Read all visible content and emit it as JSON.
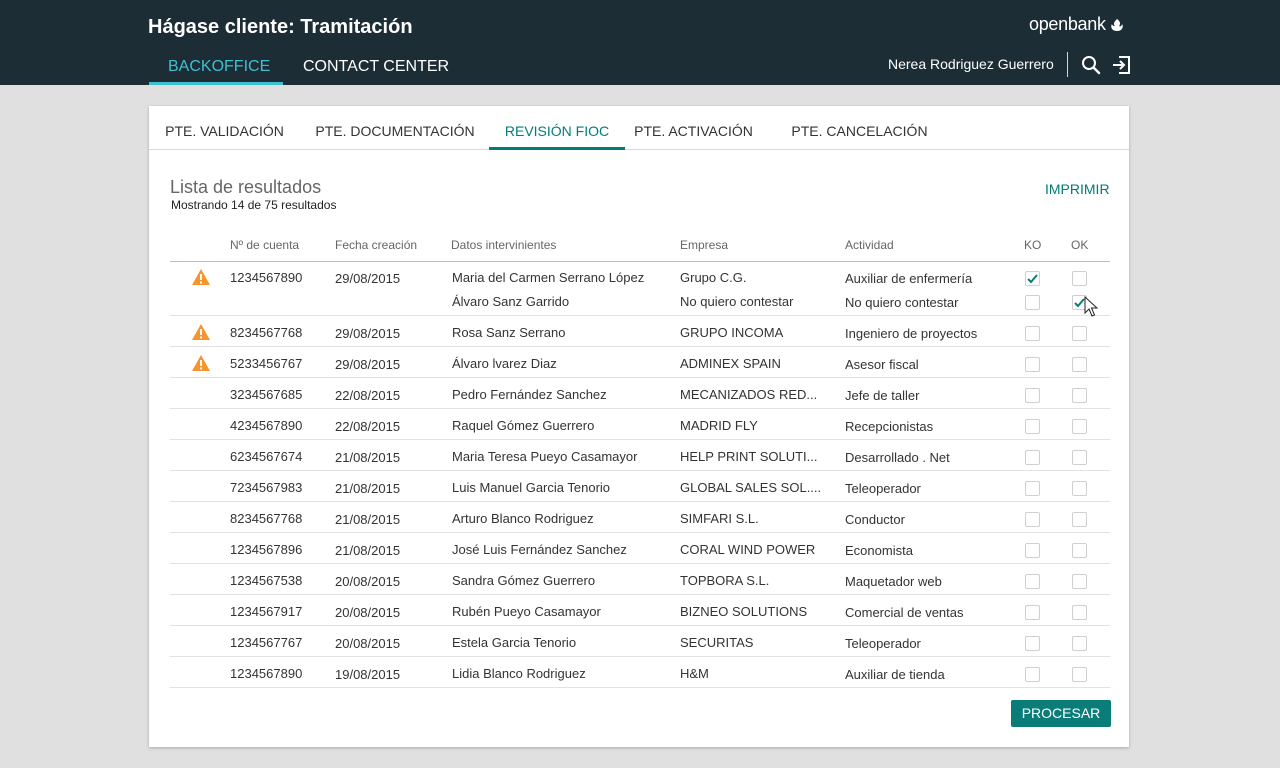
{
  "header": {
    "title": "Hágase cliente: Tramitación",
    "logo_text": "openbank",
    "nav": [
      {
        "label": "BACKOFFICE",
        "active": true
      },
      {
        "label": "CONTACT CENTER",
        "active": false
      }
    ],
    "user_name": "Nerea Rodriguez Guerrero",
    "search_icon": "search-icon",
    "logout_icon": "logout-icon"
  },
  "tabs": [
    {
      "label": "PTE. VALIDACIÓN",
      "active": false
    },
    {
      "label": "PTE. DOCUMENTACIÓN",
      "active": false
    },
    {
      "label": "REVISIÓN FIOC",
      "active": true
    },
    {
      "label": "PTE. ACTIVACIÓN",
      "active": false
    },
    {
      "label": "PTE. CANCELACIÓN",
      "active": false
    }
  ],
  "results": {
    "title": "Lista de resultados",
    "subtitle": "Mostrando 14 de 75 resultados",
    "print_label": "IMPRIMIR"
  },
  "table": {
    "columns": {
      "account": "Nº de cuenta",
      "date": "Fecha creación",
      "people": "Datos intervinientes",
      "company": "Empresa",
      "activity": "Actividad",
      "ko": "KO",
      "ok": "OK"
    },
    "rows": [
      {
        "warning": true,
        "account": "1234567890",
        "date": "29/08/2015",
        "people": [
          {
            "name": "Maria del Carmen Serrano López",
            "company": "Grupo C.G.",
            "activity": "Auxiliar de enfermería",
            "ko": true,
            "ok": false
          },
          {
            "name": "Álvaro Sanz Garrido",
            "company": "No quiero contestar",
            "activity": "No quiero contestar",
            "ko": false,
            "ok": true
          }
        ]
      },
      {
        "warning": true,
        "account": "8234567768",
        "date": "29/08/2015",
        "people": [
          {
            "name": "Rosa Sanz Serrano",
            "company": "GRUPO INCOMA",
            "activity": "Ingeniero de proyectos",
            "ko": false,
            "ok": false
          }
        ]
      },
      {
        "warning": true,
        "account": "5233456767",
        "date": "29/08/2015",
        "people": [
          {
            "name": "Álvaro lvarez Diaz",
            "company": "ADMINEX SPAIN",
            "activity": "Asesor fiscal",
            "ko": false,
            "ok": false
          }
        ]
      },
      {
        "warning": false,
        "account": "3234567685",
        "date": "22/08/2015",
        "people": [
          {
            "name": "Pedro Fernández Sanchez",
            "company": "MECANIZADOS RED...",
            "activity": "Jefe de taller",
            "ko": false,
            "ok": false
          }
        ]
      },
      {
        "warning": false,
        "account": "4234567890",
        "date": "22/08/2015",
        "people": [
          {
            "name": "Raquel Gómez Guerrero",
            "company": "MADRID FLY",
            "activity": "Recepcionistas",
            "ko": false,
            "ok": false
          }
        ]
      },
      {
        "warning": false,
        "account": "6234567674",
        "date": "21/08/2015",
        "people": [
          {
            "name": "Maria Teresa Pueyo Casamayor",
            "company": "HELP PRINT SOLUTI...",
            "activity": "Desarrollado . Net",
            "ko": false,
            "ok": false
          }
        ]
      },
      {
        "warning": false,
        "account": "7234567983",
        "date": "21/08/2015",
        "people": [
          {
            "name": "Luis Manuel Garcia Tenorio",
            "company": "GLOBAL SALES SOL....",
            "activity": "Teleoperador",
            "ko": false,
            "ok": false
          }
        ]
      },
      {
        "warning": false,
        "account": "8234567768",
        "date": "21/08/2015",
        "people": [
          {
            "name": "Arturo Blanco Rodriguez",
            "company": "SIMFARI S.L.",
            "activity": "Conductor",
            "ko": false,
            "ok": false
          }
        ]
      },
      {
        "warning": false,
        "account": "1234567896",
        "date": "21/08/2015",
        "people": [
          {
            "name": "José Luis Fernández Sanchez",
            "company": "CORAL WIND POWER",
            "activity": "Economista",
            "ko": false,
            "ok": false
          }
        ]
      },
      {
        "warning": false,
        "account": "1234567538",
        "date": "20/08/2015",
        "people": [
          {
            "name": "Sandra Gómez Guerrero",
            "company": "TOPBORA S.L.",
            "activity": "Maquetador web",
            "ko": false,
            "ok": false
          }
        ]
      },
      {
        "warning": false,
        "account": "1234567917",
        "date": "20/08/2015",
        "people": [
          {
            "name": "Rubén Pueyo Casamayor",
            "company": "BIZNEO SOLUTIONS",
            "activity": "Comercial de ventas",
            "ko": false,
            "ok": false
          }
        ]
      },
      {
        "warning": false,
        "account": "1234567767",
        "date": "20/08/2015",
        "people": [
          {
            "name": "Estela Garcia Tenorio",
            "company": "SECURITAS",
            "activity": "Teleoperador",
            "ko": false,
            "ok": false
          }
        ]
      },
      {
        "warning": false,
        "account": "1234567890",
        "date": "19/08/2015",
        "people": [
          {
            "name": "Lidia Blanco Rodriguez",
            "company": "H&M",
            "activity": "Auxiliar de tienda",
            "ko": false,
            "ok": false
          }
        ]
      }
    ]
  },
  "process_label": "PROCESAR",
  "colors": {
    "header_bg": "#1d2d35",
    "accent": "#007c79",
    "nav_active": "#3fc0d0",
    "warning": "#f7942e"
  }
}
